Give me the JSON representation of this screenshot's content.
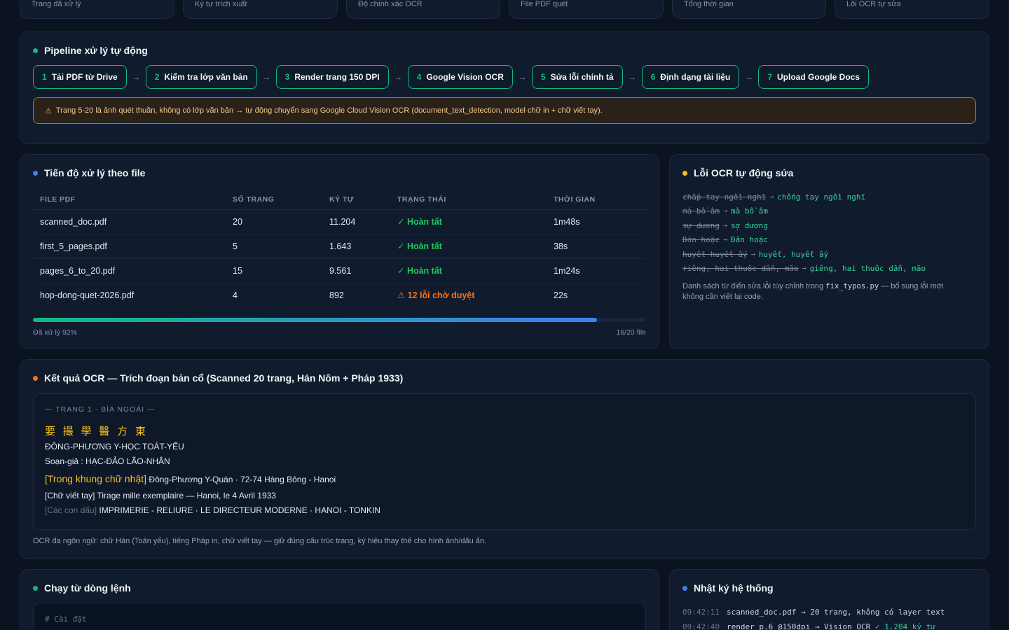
{
  "stats": [
    "Trang đã xử lý",
    "Ký tự trích xuất",
    "Độ chính xác OCR",
    "File PDF quét",
    "Tổng thời gian",
    "Lỗi OCR tự sửa"
  ],
  "pipeline": {
    "title": "Pipeline xử lý tự động",
    "dot_color": "#10b981",
    "steps": [
      {
        "num": "1",
        "label": "Tải PDF từ Drive"
      },
      {
        "num": "2",
        "label": "Kiểm tra lớp văn bản"
      },
      {
        "num": "3",
        "label": "Render trang 150 DPI"
      },
      {
        "num": "4",
        "label": "Google Vision OCR"
      },
      {
        "num": "5",
        "label": "Sửa lỗi chính tả"
      },
      {
        "num": "6",
        "label": "Định dạng tài liệu"
      },
      {
        "num": "7",
        "label": "Upload Google Docs"
      }
    ],
    "arrow": "→",
    "warning_icon": "warning-icon",
    "warning": "Trang 5-20 là ảnh quét thuần, không có lớp văn bản → tự động chuyển sang Google Cloud Vision OCR (document_text_detection, model chữ in + chữ viết tay)."
  },
  "progress": {
    "title": "Tiến độ xử lý theo file",
    "dot_color": "#3b82f6",
    "columns": [
      "FILE PDF",
      "SỐ TRANG",
      "KÝ TỰ",
      "TRẠNG THÁI",
      "THỜI GIAN"
    ],
    "rows": [
      {
        "file": "scanned_doc.pdf",
        "pages": "20",
        "chars": "11.204",
        "status": "✓ Hoàn tất",
        "status_type": "ok",
        "time": "1m48s"
      },
      {
        "file": "first_5_pages.pdf",
        "pages": "5",
        "chars": "1.643",
        "status": "✓ Hoàn tất",
        "status_type": "ok",
        "time": "38s"
      },
      {
        "file": "pages_6_to_20.pdf",
        "pages": "15",
        "chars": "9.561",
        "status": "✓ Hoàn tất",
        "status_type": "ok",
        "time": "1m24s"
      },
      {
        "file": "hop-dong-quet-2026.pdf",
        "pages": "4",
        "chars": "892",
        "status": "⚠ 12 lỗi chờ duyệt",
        "status_type": "pending",
        "time": "22s"
      }
    ],
    "percent": 92,
    "label": "Đã xử lý 92%",
    "count": "16/20 file"
  },
  "fixes": {
    "title": "Lỗi OCR tự động sửa",
    "dot_color": "#fbbf24",
    "arrow": "→",
    "items": [
      {
        "from": "chấp tay ngồi nghĩ",
        "to": "chống tay ngồi nghĩ"
      },
      {
        "from": "má bồ âm",
        "to": "mà bồ âm"
      },
      {
        "from": "sự dương",
        "to": "sợ dương"
      },
      {
        "from": "Đán hoặc",
        "to": "Đản hoặc"
      },
      {
        "from": "huyết huyết ấy",
        "to": "huyết, huyết ấy"
      },
      {
        "from": "riêng, hai thuộc dẫn, mão",
        "to": "giêng, hai thuộc dẫn, mão"
      }
    ],
    "note_before": "Danh sách từ điển sửa lỗi tùy chỉnh trong ",
    "note_code": "fix_typos.py",
    "note_after": " — bổ sung lỗi mới không cần viết lại code."
  },
  "result": {
    "title": "Kết quả OCR — Trích đoạn bản cổ (Scanned 20 trang, Hán Nôm + Pháp 1933)",
    "dot_color": "#f97316",
    "page_label": "— TRANG 1 · BÌA NGOÀI —",
    "han": "要 撮 學 醫 方 東",
    "line3": "ĐÔNG-PHƯƠNG Y-HỌC TOÁT-YẾU",
    "line4": "Soạn-giả : HẠC-ĐẢO LÃO-NHÂN",
    "line5_tag": "[Trong khung chữ nhật]",
    "line5": " Đông-Phương Y-Quán · 72-74 Hàng Bông - Hanoi",
    "line6": "[Chữ viết tay] Tirage mille exemplaire — Hanoi, le 4 Avril 1933",
    "line7_tag": "[Các con dấu]",
    "line7": " IMPRIMERIE - RELIURE · LE DIRECTEUR MODERNE · HANOI - TONKIN",
    "note": "OCR đa ngôn ngữ: chữ Hán (Toán yếu), tiếng Pháp in, chữ viết tay — giữ đúng cấu trúc trang, ký hiệu thay thế cho hình ảnh/dấu ấn."
  },
  "cli": {
    "title": "Chạy từ dòng lệnh",
    "dot_color": "#10b981",
    "comment": "# Cài đặt"
  },
  "log": {
    "title": "Nhật ký hệ thống",
    "dot_color": "#3b82f6",
    "entries": [
      {
        "time": "09:42:11",
        "msg": "scanned_doc.pdf → 20 trang, không có layer text",
        "ok": ""
      },
      {
        "time": "09:42:40",
        "msg": "render p.6 @150dpi → Vision OCR ",
        "ok": "✓ 1.204 ký tự"
      }
    ]
  }
}
